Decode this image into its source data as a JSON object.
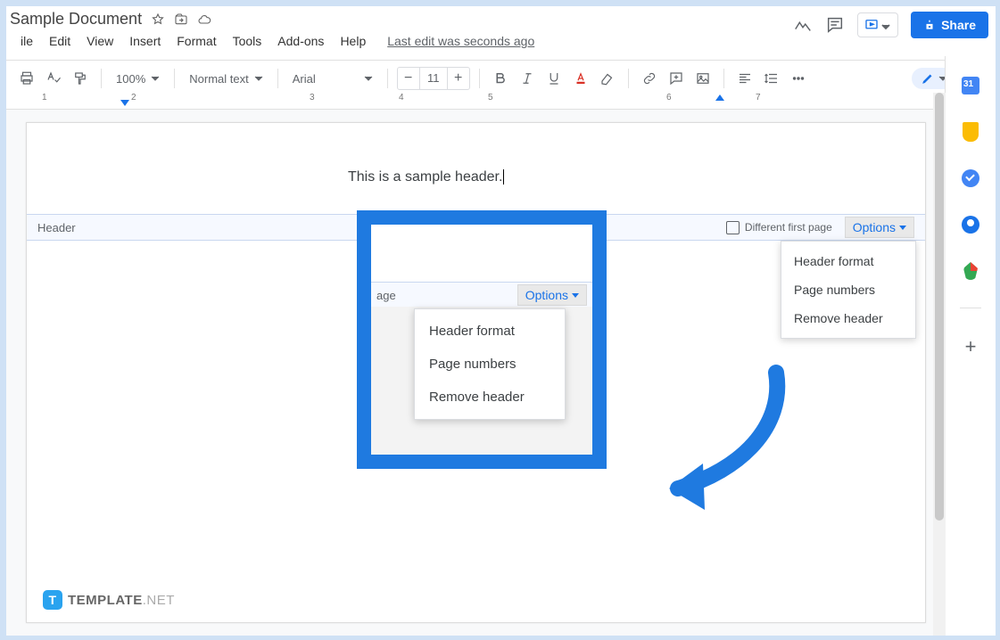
{
  "title": {
    "doc_name": "Sample Document"
  },
  "menus": [
    "ile",
    "Edit",
    "View",
    "Insert",
    "Format",
    "Tools",
    "Add-ons",
    "Help"
  ],
  "last_edit": "Last edit was seconds ago",
  "share_label": "Share",
  "toolbar": {
    "zoom": "100%",
    "style": "Normal text",
    "font": "Arial",
    "font_size": "11"
  },
  "ruler": {
    "nums": [
      "1",
      "2",
      "3",
      "4",
      "5",
      "6",
      "7"
    ]
  },
  "page": {
    "header_text": "This is a sample header.",
    "header_label": "Header",
    "dfp_label": "Different first page",
    "options_label": "Options"
  },
  "dropdown_main": [
    "Header format",
    "Page numbers",
    "Remove header"
  ],
  "inset": {
    "page_label": "age",
    "options_label": "Options",
    "items": [
      "Header format",
      "Page numbers",
      "Remove header"
    ]
  },
  "footer": {
    "brand": "TEMPLATE",
    "suffix": ".NET"
  }
}
